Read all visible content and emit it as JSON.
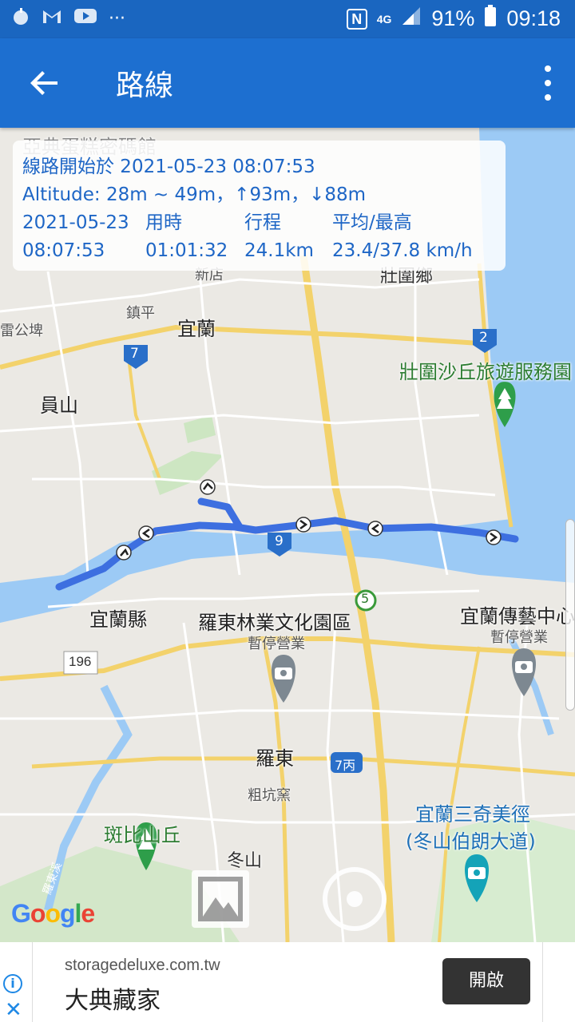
{
  "status_bar": {
    "left_icons": [
      "app-icon",
      "gmail-icon",
      "youtube-icon",
      "more-icon"
    ],
    "more": "···",
    "nfc": "N",
    "network": "4G",
    "battery": "91%",
    "time": "09:18"
  },
  "app_bar": {
    "title": "路線",
    "back_icon": "arrow-back-icon",
    "menu_icon": "more-vert-icon"
  },
  "route_info": {
    "start_line": "線路開始於 2021-05-23 08:07:53",
    "altitude_line": "Altitude: 28m ~ 49m，↑93m，↓88m",
    "date": "2021-05-23",
    "time": "08:07:53",
    "duration_label": "用時",
    "duration_value": "01:01:32",
    "distance_label": "行程",
    "distance_value": "24.1km",
    "speed_label": "平均/最高",
    "speed_value": "23.4/37.8 km/h"
  },
  "map": {
    "labels": {
      "top_poi": "亞典蛋糕密碼館",
      "xindian": "新店",
      "zhuangwei": "壯圍鄉",
      "zhenping": "鎮平",
      "yilan": "宜蘭",
      "leigongpi": "雷公埤",
      "yuanshan": "員山",
      "zhuangwei_dune": "壯圍沙丘旅遊服務園",
      "yilan_county": "宜蘭縣",
      "luodong_forest": "羅東林業文化園區",
      "luodong_forest_status": "暫停營業",
      "yilan_arts": "宜蘭傳藝中心",
      "yilan_arts_status": "暫停營業",
      "road_196": "196",
      "luodong": "羅東",
      "road_7c": "7丙",
      "fengkengku": "粗坑窯",
      "sanqi_1": "宜蘭三奇美徑",
      "sanqi_2": "(冬山伯朗大道)",
      "banbi": "斑比山丘",
      "dongshan": "冬山",
      "river_label": "羅東溪",
      "road_7": "7",
      "road_2": "2",
      "road_9": "9",
      "road_5": "5"
    },
    "logo": "Google"
  },
  "ad": {
    "url": "storagedeluxe.com.tw",
    "title": "大典藏家",
    "button": "開啟",
    "info_icon": "i",
    "close_icon": "✕"
  }
}
